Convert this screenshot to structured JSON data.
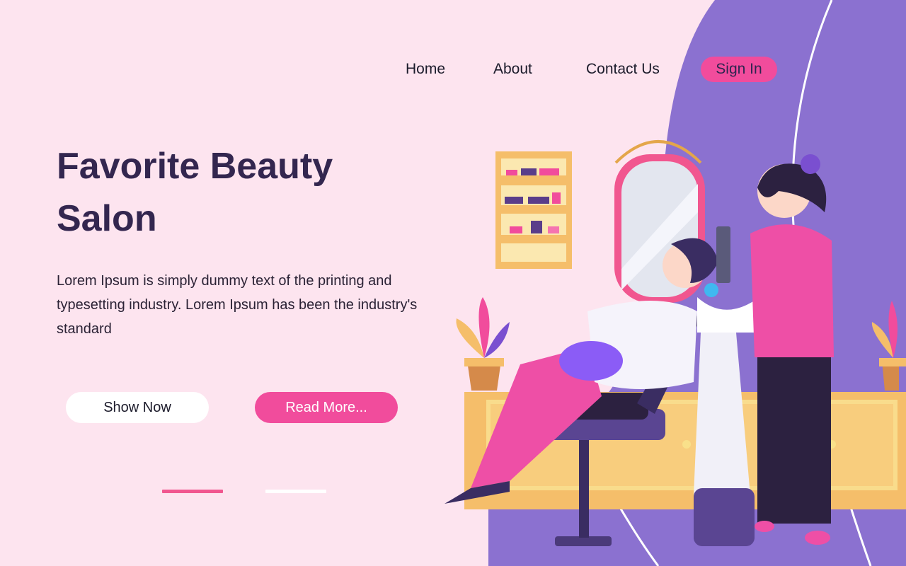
{
  "nav": {
    "items": [
      {
        "label": "Home"
      },
      {
        "label": "About"
      },
      {
        "label": "Contact Us"
      }
    ],
    "signin_label": "Sign In"
  },
  "hero": {
    "title": "Favorite Beauty Salon",
    "description": "Lorem Ipsum is simply dummy text of the printing and typesetting industry. Lorem Ipsum has been the industry's standard",
    "show_button": "Show Now",
    "read_button": "Read More..."
  },
  "carousel": {
    "count": 2,
    "active_index": 0
  },
  "colors": {
    "background": "#fde4ef",
    "accent": "#f14c9c",
    "purple_panel": "#8b71d0",
    "heading": "#33264f"
  },
  "illustration": {
    "subject": "hair salon: stylist washing a client's hair at a shampoo basin",
    "icons": [
      "shelf-icon",
      "mirror-icon",
      "plant-icon",
      "chair-icon",
      "stylist-icon",
      "client-icon"
    ]
  }
}
